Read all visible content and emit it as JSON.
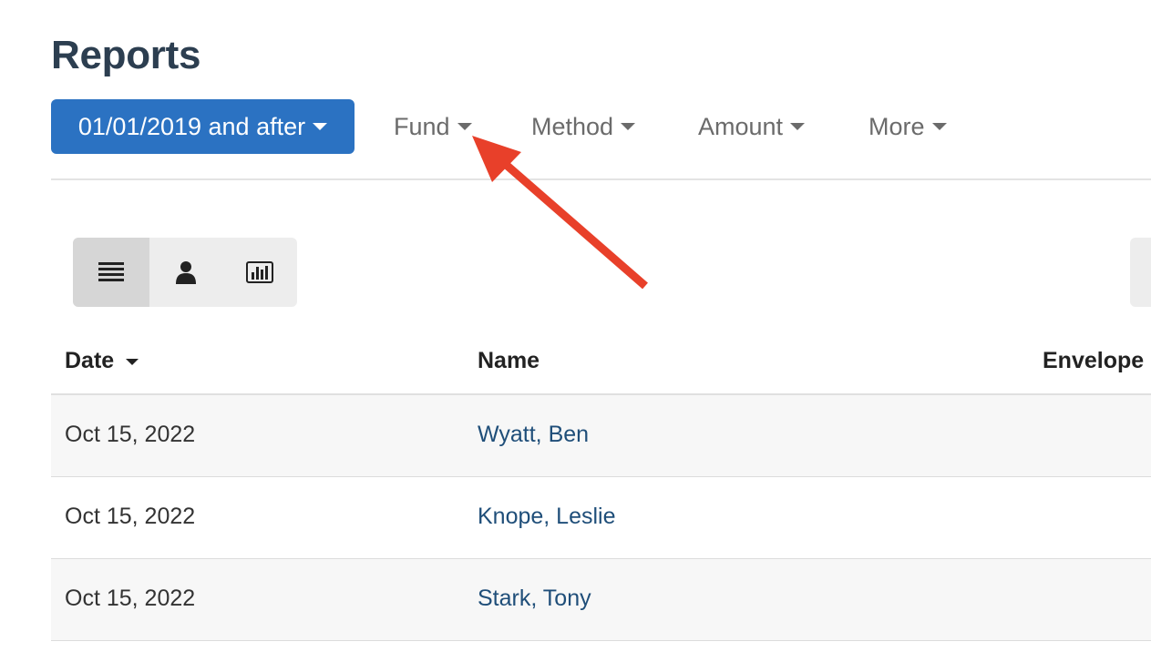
{
  "page": {
    "title": "Reports"
  },
  "filters": {
    "date": "01/01/2019 and after",
    "fund": "Fund",
    "method": "Method",
    "amount": "Amount",
    "more": "More"
  },
  "view_toggle": {
    "options": [
      {
        "icon": "list-icon",
        "active": true
      },
      {
        "icon": "person-icon",
        "active": false
      },
      {
        "icon": "chart-icon",
        "active": false
      }
    ]
  },
  "table": {
    "columns": {
      "date": "Date",
      "name": "Name",
      "envelope": "Envelope"
    },
    "rows": [
      {
        "date": "Oct 15, 2022",
        "name": "Wyatt, Ben"
      },
      {
        "date": "Oct 15, 2022",
        "name": "Knope, Leslie"
      },
      {
        "date": "Oct 15, 2022",
        "name": "Stark, Tony"
      }
    ]
  },
  "colors": {
    "accent": "#2b72c2",
    "link": "#1f4e79",
    "annotation_arrow": "#e8402a",
    "title": "#2c3e50"
  }
}
